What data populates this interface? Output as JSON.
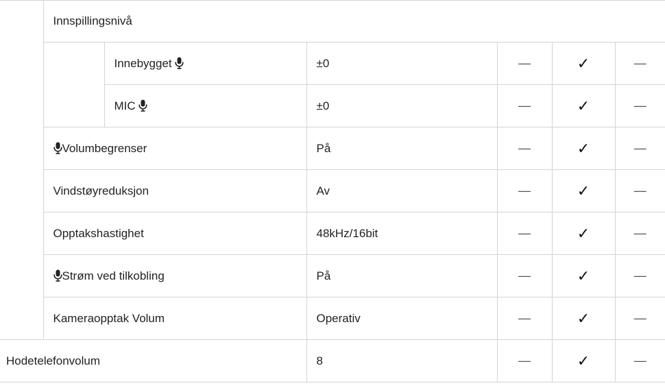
{
  "rows": {
    "recording_level": {
      "label": "Innspillingsnivå"
    },
    "built_in": {
      "label": "Innebygget",
      "value": "±0",
      "marks": [
        "—",
        "✓",
        "—"
      ]
    },
    "mic": {
      "label": "MIC",
      "value": "±0",
      "marks": [
        "—",
        "✓",
        "—"
      ]
    },
    "volume_limiter": {
      "label": "Volumbegrenser",
      "value": "På",
      "marks": [
        "—",
        "✓",
        "—"
      ]
    },
    "wind_noise": {
      "label": "Vindstøyreduksjon",
      "value": "Av",
      "marks": [
        "—",
        "✓",
        "—"
      ]
    },
    "recording_rate": {
      "label": "Opptakshastighet",
      "value": "48kHz/16bit",
      "marks": [
        "—",
        "✓",
        "—"
      ]
    },
    "plug_in_power": {
      "label": "Strøm ved tilkobling",
      "value": "På",
      "marks": [
        "—",
        "✓",
        "—"
      ]
    },
    "camera_rec_volume": {
      "label": "Kameraopptak Volum",
      "value": "Operativ",
      "marks": [
        "—",
        "✓",
        "—"
      ]
    },
    "headphone_volume": {
      "label": "Hodetelefonvolum",
      "value": "8",
      "marks": [
        "—",
        "✓",
        "—"
      ]
    }
  },
  "icons": {
    "microphone": "microphone-icon",
    "check": "checkmark-icon",
    "dash": "dash-icon"
  }
}
